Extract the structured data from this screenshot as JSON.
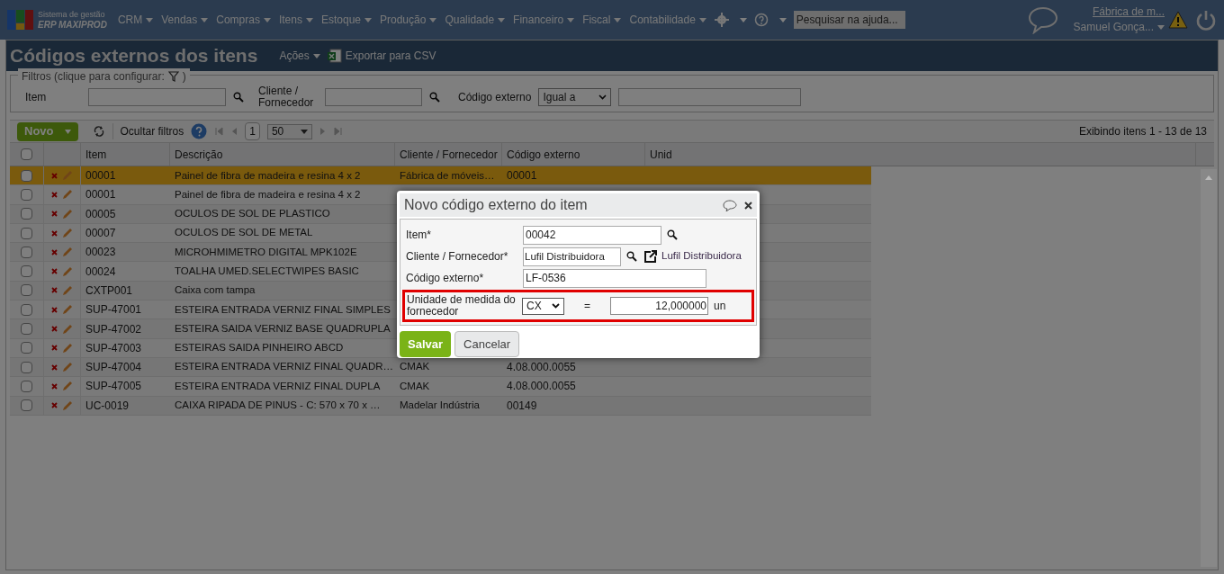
{
  "nav": {
    "logo_line1": "Sistema de gestão",
    "logo_line2": "ERP MAXIPROD",
    "menus": [
      "CRM",
      "Vendas",
      "Compras",
      "Itens",
      "Estoque",
      "Produção",
      "Qualidade",
      "Financeiro",
      "Fiscal",
      "Contabilidade"
    ],
    "help_search": {
      "placeholder": "Pesquisar na ajuda..."
    },
    "company": "Fábrica de m...",
    "user": "Samuel Gonça..."
  },
  "page": {
    "title": "Códigos externos dos itens",
    "actions": "Ações",
    "export": "Exportar para CSV"
  },
  "filters": {
    "legend_before": "Filtros (clique para configurar:",
    "legend_after": ")",
    "item_label": "Item",
    "partner_label": "Cliente / Fornecedor",
    "code_label": "Código externo",
    "code_operator": "Igual a"
  },
  "toolbar": {
    "new": "Novo",
    "hide_filters": "Ocultar filtros",
    "page": "1",
    "page_size": "50",
    "status": "Exibindo itens 1 - 13 de 13"
  },
  "table": {
    "select_all_checked": false,
    "columns": [
      "Item",
      "Descrição",
      "Cliente / Fornecedor",
      "Código externo",
      "Unid"
    ],
    "rows": [
      {
        "item": "00001",
        "description": "Painel de fibra de madeira e resina 4 x 2",
        "partner": "Fábrica de móveis…",
        "code": "00001",
        "checked": false,
        "selected": true
      },
      {
        "item": "00001",
        "description": "Painel de fibra de madeira e resina 4 x 2",
        "checked": false,
        "selected": false
      },
      {
        "item": "00005",
        "description": "OCULOS DE SOL DE PLASTICO",
        "checked": false,
        "selected": false
      },
      {
        "item": "00007",
        "description": "OCULOS DE SOL DE METAL",
        "checked": false,
        "selected": false
      },
      {
        "item": "00023",
        "description": "MICROHMIMETRO DIGITAL MPK102E",
        "checked": false,
        "selected": false
      },
      {
        "item": "00024",
        "description": "TOALHA UMED.SELECTWIPES BASIC",
        "checked": false,
        "selected": false
      },
      {
        "item": "CXTP001",
        "description": "Caixa com tampa",
        "checked": false,
        "selected": false
      },
      {
        "item": "SUP-47001",
        "description": "ESTEIRA ENTRADA VERNIZ FINAL SIMPLES",
        "checked": false,
        "selected": false
      },
      {
        "item": "SUP-47002",
        "description": "ESTEIRA SAIDA VERNIZ BASE QUADRUPLA",
        "checked": false,
        "selected": false
      },
      {
        "item": "SUP-47003",
        "description": "ESTEIRAS SAIDA PINHEIRO ABCD",
        "checked": false,
        "selected": false
      },
      {
        "item": "SUP-47004",
        "description": "ESTEIRA ENTRADA VERNIZ FINAL QUADR…",
        "partner": "CMAK",
        "code": "4.08.000.0055",
        "checked": false,
        "selected": false
      },
      {
        "item": "SUP-47005",
        "description": "ESTEIRA ENTRADA VERNIZ FINAL DUPLA",
        "partner": "CMAK",
        "code": "4.08.000.0055",
        "checked": false,
        "selected": false
      },
      {
        "item": "UC-0019",
        "description": "CAIXA RIPADA DE PINUS - C: 570 x 70 x …",
        "partner": "Madelar Indústria",
        "code": "00149",
        "checked": false,
        "selected": false
      }
    ]
  },
  "dialog": {
    "title": "Novo código externo do item",
    "item_label": "Item*",
    "item_value": "00042",
    "partner_label": "Cliente / Fornecedor*",
    "partner_value": "Lufil Distribuidora",
    "partner_link": "Lufil Distribuidora",
    "code_label": "Código externo*",
    "code_value": "LF-0536",
    "unit_label": "Unidade de medida do fornecedor",
    "unit_value": "CX",
    "equals": "=",
    "factor_value": "12,000000",
    "base_unit": "un",
    "save": "Salvar",
    "cancel": "Cancelar"
  }
}
